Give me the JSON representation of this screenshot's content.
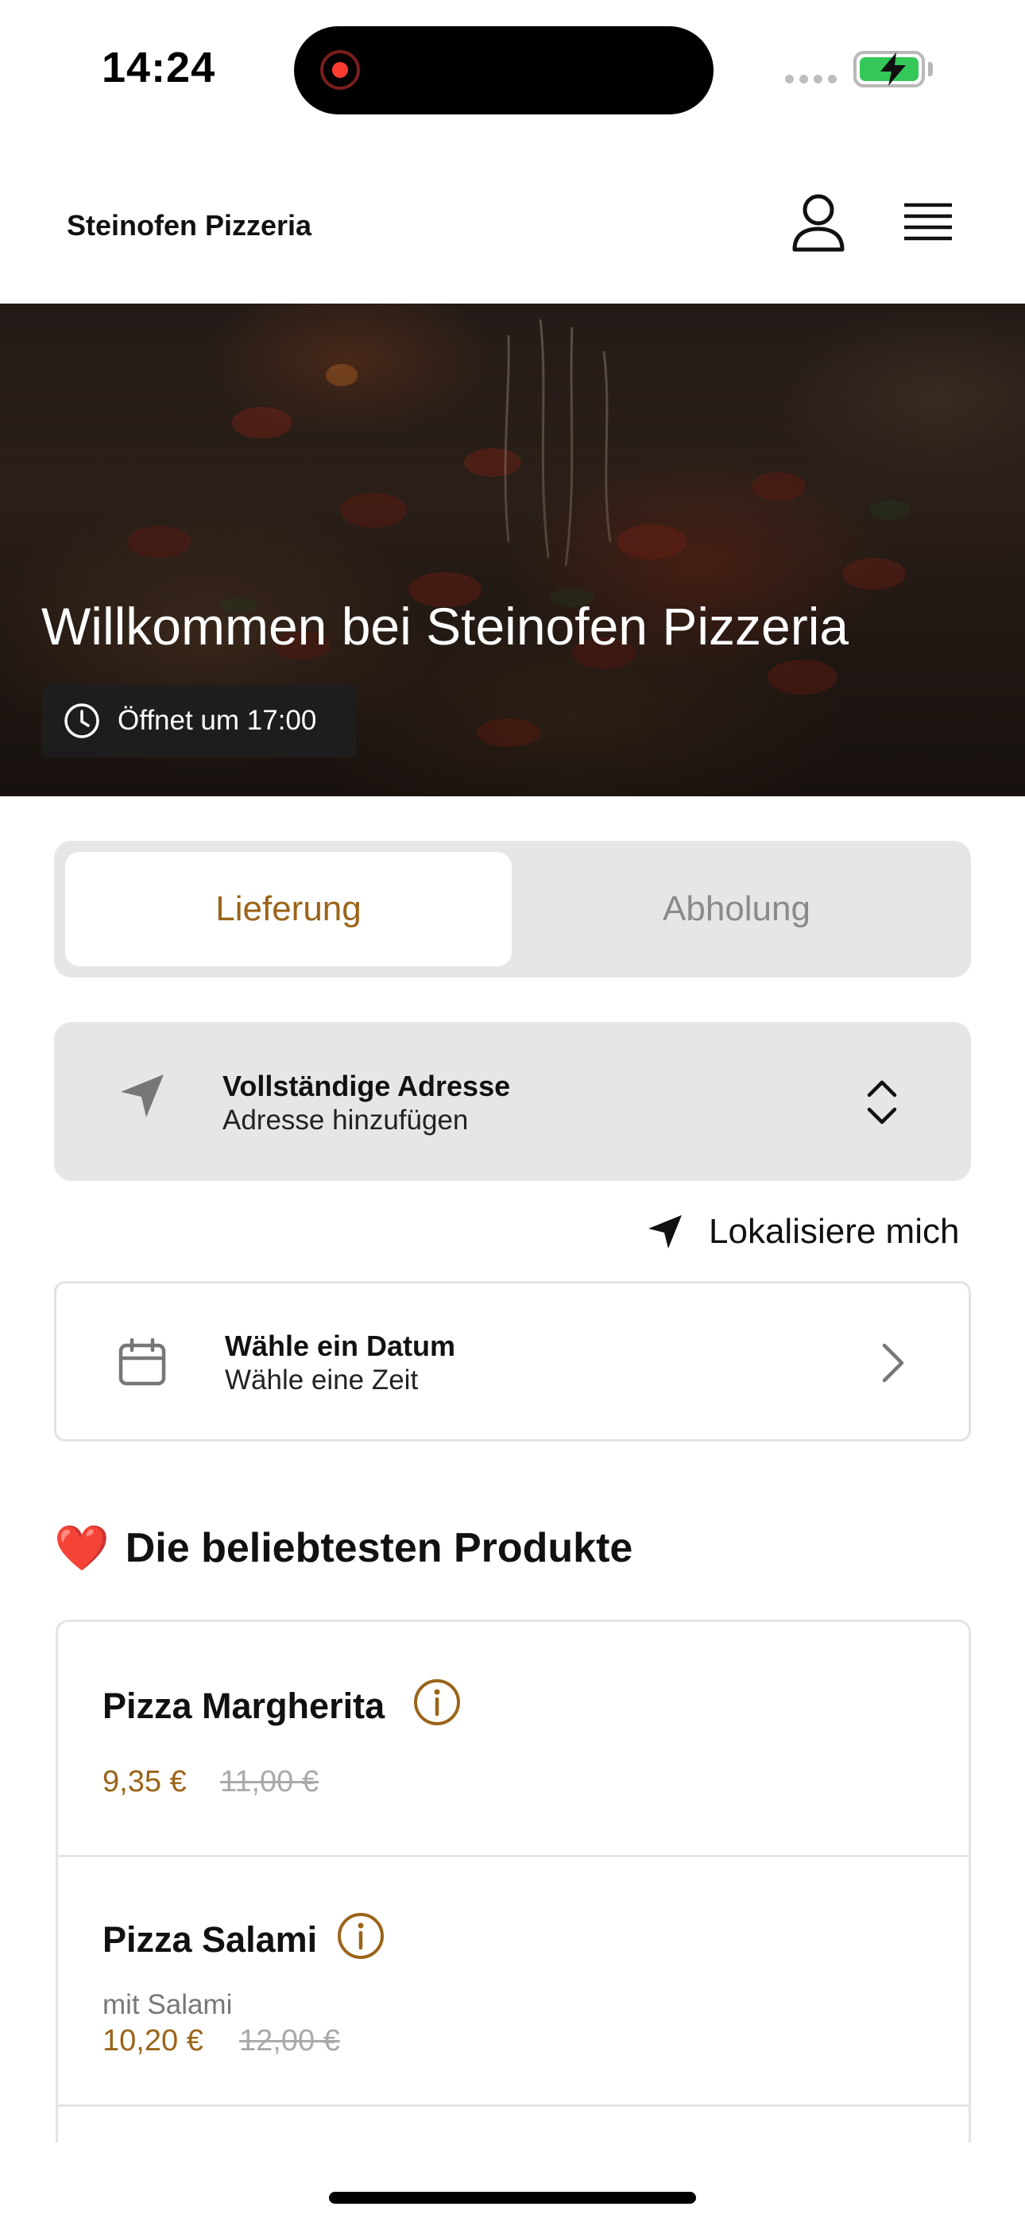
{
  "status_bar": {
    "time": "14:24"
  },
  "header": {
    "brand": "Steinofen Pizzeria",
    "user_icon": "person-icon",
    "menu_icon": "hamburger-menu-icon"
  },
  "hero": {
    "title": "Willkommen bei Steinofen Pizzeria",
    "opening_text": "Öffnet um 17:00",
    "opening_icon": "clock-icon"
  },
  "order_mode": {
    "options": [
      "Lieferung",
      "Abholung"
    ],
    "selected": "Lieferung"
  },
  "address": {
    "label": "Vollständige Adresse",
    "value": "Adresse hinzufügen",
    "icon": "navigation-arrow-icon"
  },
  "locate": {
    "label": "Lokalisiere mich"
  },
  "schedule": {
    "date_label": "Wähle ein Datum",
    "time_label": "Wähle eine Zeit"
  },
  "popular": {
    "emoji": "❤️",
    "title": "Die beliebtesten Produkte",
    "products": [
      {
        "name": "Pizza Margherita",
        "description": "",
        "price": "9,35 €",
        "old_price": "11,00 €"
      },
      {
        "name": "Pizza Salami",
        "description": "mit Salami",
        "price": "10,20 €",
        "old_price": "12,00 €"
      }
    ]
  },
  "colors": {
    "accent": "#9a6419",
    "segment_bg": "#e6e6e6",
    "inactive_text": "#8a8a8a",
    "battery_green": "#34c759"
  }
}
